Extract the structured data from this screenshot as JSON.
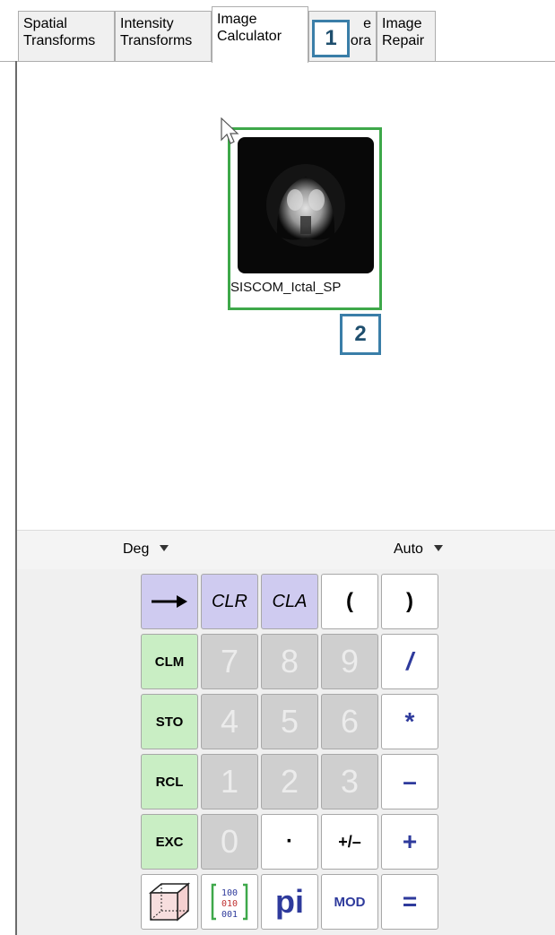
{
  "tabs": [
    {
      "line1": "Spatial",
      "line2": "Transforms"
    },
    {
      "line1": "Intensity",
      "line2": "Transforms"
    },
    {
      "line1": "Image",
      "line2": "Calculator"
    },
    {
      "line1": "e",
      "line2": "ora"
    },
    {
      "line1": "Image",
      "line2": "Repair"
    }
  ],
  "callouts": {
    "one": "1",
    "two": "2"
  },
  "thumbnail": {
    "label": "SISCOM_Ictal_SP"
  },
  "options": {
    "angle_mode": "Deg",
    "scale_mode": "Auto"
  },
  "keys": {
    "arrow": "→",
    "clr": "CLR",
    "cla": "CLA",
    "lparen": "(",
    "rparen": ")",
    "clm": "CLM",
    "sto": "STO",
    "rcl": "RCL",
    "exc": "EXC",
    "d7": "7",
    "d8": "8",
    "d9": "9",
    "d4": "4",
    "d5": "5",
    "d6": "6",
    "d1": "1",
    "d2": "2",
    "d3": "3",
    "d0": "0",
    "dot": "·",
    "plusminus": "+/–",
    "divide": "/",
    "multiply": "*",
    "minus": "–",
    "plus": "+",
    "matrix_top": "100",
    "matrix_mid": "010",
    "matrix_bot": "001",
    "pi": "pi",
    "mod": "MOD",
    "equals": "="
  },
  "colors": {
    "frame": "#3ea84a",
    "callout_border": "#3a7ea8",
    "lavender": "#cfcbf0",
    "green_key": "#c9eec4",
    "digit_key": "#cfcfcf",
    "operator_text": "#2e3a9c"
  }
}
